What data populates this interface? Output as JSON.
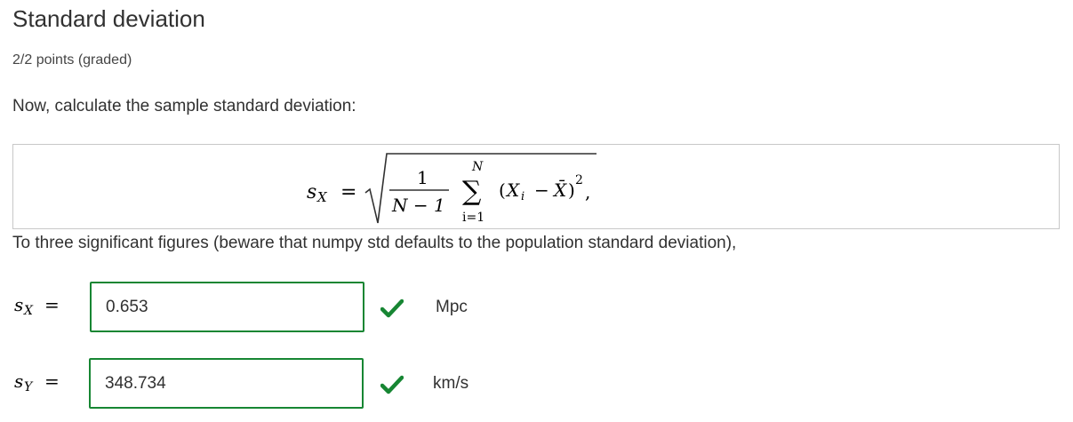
{
  "problem": {
    "title": "Standard deviation",
    "points": "2/2 points (graded)",
    "prompt": "Now, calculate the sample standard deviation:",
    "instruction": "To three significant figures (beware that numpy std defaults to the population standard deviation),"
  },
  "formula": {
    "lhs_var": "s",
    "lhs_sub": "X",
    "equals": "=",
    "numerator": "1",
    "denominator": "N − 1",
    "sum_upper": "N",
    "sum_lower": "i=1",
    "sum_symbol": "∑",
    "term_open": "(",
    "term_X": "X",
    "term_i": "i",
    "term_minus": "−",
    "term_Xbar": "X̄",
    "term_close": ")",
    "exponent": "2",
    "trailing": ","
  },
  "answers": [
    {
      "var": "s",
      "sub": "X",
      "equals": "=",
      "value": "0.653",
      "status": "correct",
      "unit": "Mpc"
    },
    {
      "var": "s",
      "sub": "Y",
      "equals": "=",
      "value": "348.734",
      "status": "correct",
      "unit": "km/s"
    }
  ],
  "colors": {
    "correct": "#178633",
    "text": "#313131",
    "border": "#c8c8c8"
  }
}
